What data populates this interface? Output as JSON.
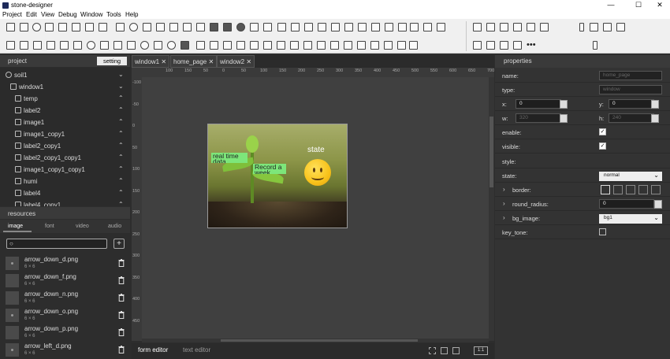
{
  "window": {
    "title": "stone-designer",
    "minimize": "—",
    "maximize": "☐",
    "close": "✕"
  },
  "menu": [
    "Project",
    "Edit",
    "View",
    "Debug",
    "Window",
    "Tools",
    "Help"
  ],
  "project": {
    "heading": "project",
    "setting_label": "setting",
    "tree": [
      {
        "name": "soil1",
        "indent": 0,
        "icon": "project",
        "chevron": "⌄"
      },
      {
        "name": "window1",
        "indent": 1,
        "icon": "window",
        "chevron": "⌄"
      },
      {
        "name": "temp",
        "indent": 2,
        "icon": "label",
        "chevron": "⌃"
      },
      {
        "name": "label2",
        "indent": 2,
        "icon": "label",
        "chevron": "⌃"
      },
      {
        "name": "image1",
        "indent": 2,
        "icon": "image",
        "chevron": "⌃"
      },
      {
        "name": "image1_copy1",
        "indent": 2,
        "icon": "image",
        "chevron": "⌃"
      },
      {
        "name": "label2_copy1",
        "indent": 2,
        "icon": "label",
        "chevron": "⌃"
      },
      {
        "name": "label2_copy1_copy1",
        "indent": 2,
        "icon": "label",
        "chevron": "⌃"
      },
      {
        "name": "image1_copy1_copy1",
        "indent": 2,
        "icon": "image",
        "chevron": "⌃"
      },
      {
        "name": "humi",
        "indent": 2,
        "icon": "label",
        "chevron": "⌃"
      },
      {
        "name": "label4",
        "indent": 2,
        "icon": "label",
        "chevron": "⌃"
      },
      {
        "name": "label4_copy1",
        "indent": 2,
        "icon": "label",
        "chevron": "⌃"
      }
    ]
  },
  "resources": {
    "heading": "resources",
    "tabs": [
      "image",
      "font",
      "video",
      "audio"
    ],
    "active_tab": "image",
    "search_placeholder": "",
    "add_label": "+",
    "assets": [
      {
        "name": "arrow_down_d.png",
        "size": "6 × 6"
      },
      {
        "name": "arrow_down_f.png",
        "size": "6 × 6"
      },
      {
        "name": "arrow_down_n.png",
        "size": "6 × 6"
      },
      {
        "name": "arrow_down_o.png",
        "size": "6 × 6"
      },
      {
        "name": "arrow_down_p.png",
        "size": "6 × 6"
      },
      {
        "name": "arrow_left_d.png",
        "size": "6 × 6"
      }
    ]
  },
  "editor": {
    "tabs": [
      "window1",
      "home_page",
      "window2"
    ],
    "tab_close": "✕",
    "hruler_ticks": [
      "100",
      "150",
      "50",
      "0",
      "50",
      "100",
      "150",
      "200",
      "250",
      "300",
      "350",
      "400",
      "450",
      "500",
      "550",
      "600",
      "650",
      "700"
    ],
    "vruler_ticks": [
      "-100",
      "-50",
      "0",
      "50",
      "100",
      "150",
      "200",
      "250",
      "300",
      "350",
      "400",
      "450"
    ],
    "canvas_labels": {
      "temp": "real time data",
      "humi": "Record a week",
      "state": "state"
    },
    "bottom_tabs": [
      "form editor",
      "text editor"
    ],
    "active_bottom_tab": "form editor",
    "zoom": "1:1"
  },
  "properties": {
    "heading": "properties",
    "name_label": "name:",
    "name_value": "home_page",
    "type_label": "type:",
    "type_value": "window",
    "x_label": "x:",
    "x_value": "0",
    "y_label": "y:",
    "y_value": "0",
    "w_label": "w:",
    "w_value": "320",
    "h_label": "h:",
    "h_value": "240",
    "enable_label": "enable:",
    "enable_checked": "✓",
    "visible_label": "visible:",
    "visible_checked": "✓",
    "style_label": "style:",
    "state_label": "state:",
    "state_value": "normal",
    "border_label": "border:",
    "round_radius_label": "round_radius:",
    "round_radius_value": "0",
    "bg_image_label": "bg_image:",
    "bg_image_value": "bg1",
    "key_tone_label": "key_tone:",
    "expand_glyph": "›",
    "dropdown_glyph": "⌄"
  }
}
